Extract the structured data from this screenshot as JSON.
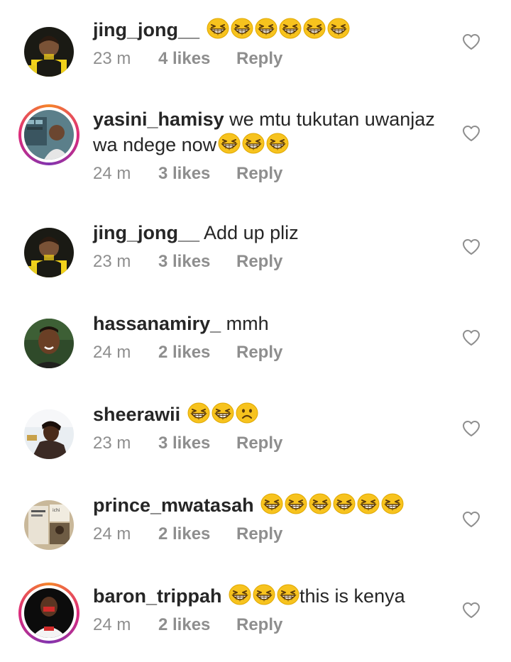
{
  "comments": [
    {
      "username": "jing_jong__",
      "text": "",
      "emojis": [
        "grin",
        "grin",
        "grin",
        "grin",
        "grin",
        "grin"
      ],
      "emojis_after": [],
      "time": "23 m",
      "likes": "4 likes",
      "reply": "Reply",
      "story_ring": false,
      "avatar": "avatar-dark-yellow"
    },
    {
      "username": "yasini_hamisy",
      "text": "we mtu tukutan uwanjaz wa ndege now",
      "emojis": [],
      "emojis_after": [
        "grin",
        "grin",
        "grin"
      ],
      "time": "24 m",
      "likes": "3 likes",
      "reply": "Reply",
      "story_ring": true,
      "avatar": "avatar-studio"
    },
    {
      "username": "jing_jong__",
      "text": "Add up pliz",
      "emojis": [],
      "emojis_after": [],
      "time": "23 m",
      "likes": "3 likes",
      "reply": "Reply",
      "story_ring": false,
      "avatar": "avatar-dark-yellow"
    },
    {
      "username": "hassanamiry_",
      "text": "mmh",
      "emojis": [],
      "emojis_after": [],
      "time": "24 m",
      "likes": "2 likes",
      "reply": "Reply",
      "story_ring": false,
      "avatar": "avatar-smile"
    },
    {
      "username": "sheerawii",
      "text": "",
      "emojis": [
        "grin",
        "grin",
        "sad"
      ],
      "emojis_after": [],
      "time": "23 m",
      "likes": "3 likes",
      "reply": "Reply",
      "story_ring": false,
      "avatar": "avatar-light"
    },
    {
      "username": "prince_mwatasah",
      "text": "",
      "emojis": [
        "grin",
        "grin",
        "grin",
        "grin",
        "grin",
        "grin"
      ],
      "emojis_after": [],
      "time": "24 m",
      "likes": "2 likes",
      "reply": "Reply",
      "story_ring": false,
      "avatar": "avatar-poster"
    },
    {
      "username": "baron_trippah",
      "text": "this is kenya",
      "emojis": [
        "grin",
        "grin",
        "grin"
      ],
      "emojis_after": [],
      "time": "24 m",
      "likes": "2 likes",
      "reply": "Reply",
      "story_ring": true,
      "avatar": "avatar-red-mask"
    }
  ],
  "colors": {
    "username": "#262626",
    "meta": "#8e8e8e",
    "emoji_face": "#f7c31e",
    "heart_outline": "#8e8e8e"
  },
  "icons": {
    "like": "heart-outline-icon",
    "grin": "grinning-squinting-face-emoji",
    "sad": "frowning-face-emoji"
  }
}
